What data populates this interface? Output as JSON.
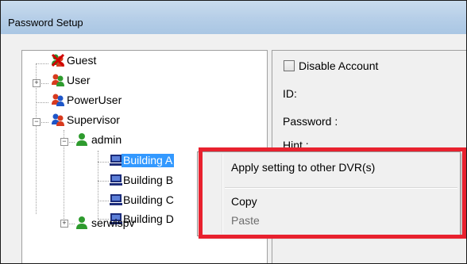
{
  "window": {
    "title": "Password Setup"
  },
  "tree": {
    "items": [
      {
        "label": "Guest",
        "icon": "group-disabled-icon"
      },
      {
        "label": "User",
        "icon": "group-user-icon"
      },
      {
        "label": "PowerUser",
        "icon": "group-poweruser-icon"
      },
      {
        "label": "Supervisor",
        "icon": "group-supervisor-icon"
      },
      {
        "label": "admin",
        "icon": "user-icon"
      },
      {
        "label": "Building A",
        "icon": "dvr-computer-icon",
        "selected": true
      },
      {
        "label": "Building B",
        "icon": "dvr-computer-icon"
      },
      {
        "label": "Building C",
        "icon": "dvr-computer-icon"
      },
      {
        "label": "Building D",
        "icon": "dvr-computer-icon"
      },
      {
        "label": "serwispv",
        "icon": "user-icon"
      }
    ],
    "expanders": {
      "user": "+",
      "supervisor": "−",
      "admin": "−",
      "serwispv": "+"
    }
  },
  "details": {
    "disable_account_label": "Disable Account",
    "disable_account_checked": false,
    "id_label": "ID:",
    "password_label": "Password :",
    "hint_label": "Hint :"
  },
  "context_menu": {
    "apply_label": "Apply setting to other DVR(s)",
    "copy_label": "Copy",
    "paste_label": "Paste",
    "paste_enabled": false
  },
  "colors": {
    "selection": "#3399ff",
    "highlight_box": "#e8212e",
    "disabled_text": "#6d6d6d"
  }
}
